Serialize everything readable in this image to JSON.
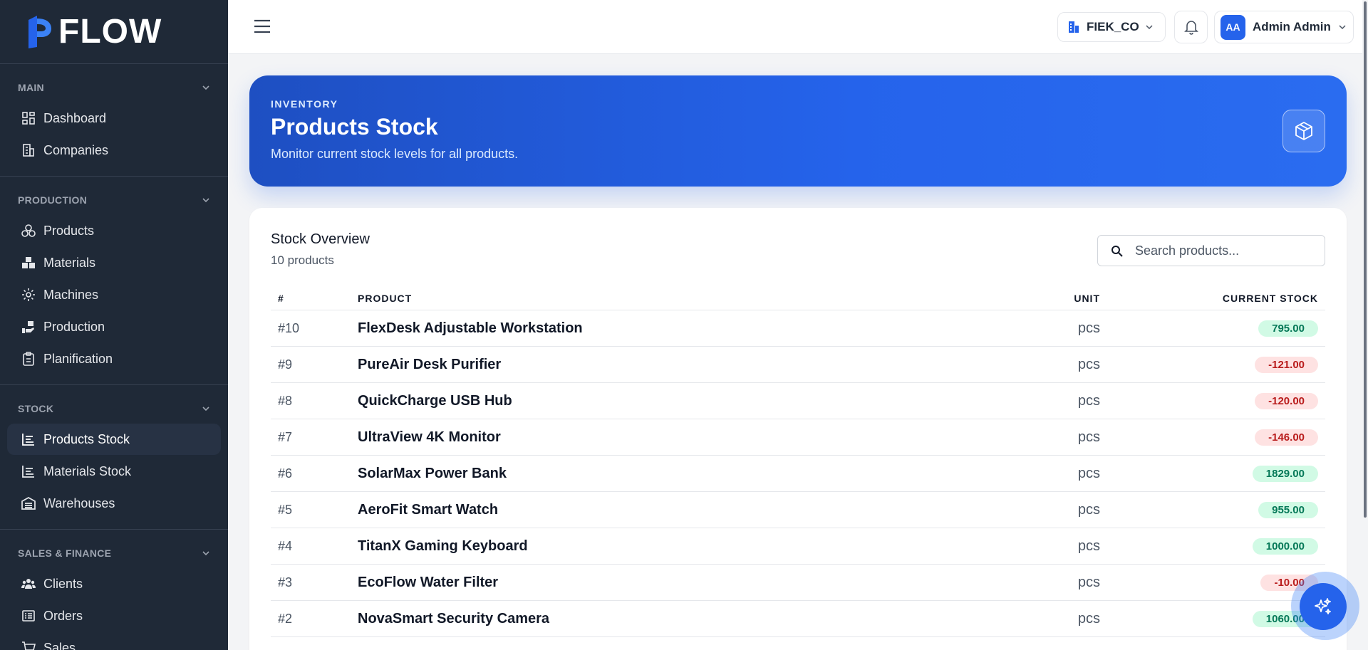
{
  "app": {
    "logo_text": "FLOW"
  },
  "sidebar": {
    "sections": [
      {
        "title": "MAIN",
        "items": [
          {
            "label": "Dashboard",
            "icon": "dashboard-icon"
          },
          {
            "label": "Companies",
            "icon": "building-icon"
          }
        ]
      },
      {
        "title": "PRODUCTION",
        "items": [
          {
            "label": "Products",
            "icon": "products-icon"
          },
          {
            "label": "Materials",
            "icon": "boxes-icon"
          },
          {
            "label": "Machines",
            "icon": "gear-icon"
          },
          {
            "label": "Production",
            "icon": "hand-box-icon"
          },
          {
            "label": "Planification",
            "icon": "clipboard-icon"
          }
        ]
      },
      {
        "title": "STOCK",
        "items": [
          {
            "label": "Products Stock",
            "icon": "chart-icon",
            "active": true
          },
          {
            "label": "Materials Stock",
            "icon": "chart-icon"
          },
          {
            "label": "Warehouses",
            "icon": "warehouse-icon"
          }
        ]
      },
      {
        "title": "SALES & FINANCE",
        "items": [
          {
            "label": "Clients",
            "icon": "users-icon"
          },
          {
            "label": "Orders",
            "icon": "orders-icon"
          },
          {
            "label": "Sales",
            "icon": "cart-icon"
          }
        ]
      }
    ]
  },
  "topbar": {
    "company": "FIEK_CO",
    "user_initials": "AA",
    "user_name": "Admin Admin"
  },
  "banner": {
    "eyebrow": "INVENTORY",
    "title": "Products Stock",
    "subtitle": "Monitor current stock levels for all products."
  },
  "card": {
    "title": "Stock Overview",
    "subtitle": "10 products",
    "search_placeholder": "Search products..."
  },
  "table": {
    "headers": {
      "num": "#",
      "product": "PRODUCT",
      "unit": "UNIT",
      "stock": "CURRENT STOCK"
    },
    "rows": [
      {
        "num": "#10",
        "product": "FlexDesk Adjustable Workstation",
        "unit": "pcs",
        "stock": "795.00",
        "status": "pos"
      },
      {
        "num": "#9",
        "product": "PureAir Desk Purifier",
        "unit": "pcs",
        "stock": "-121.00",
        "status": "neg"
      },
      {
        "num": "#8",
        "product": "QuickCharge USB Hub",
        "unit": "pcs",
        "stock": "-120.00",
        "status": "neg"
      },
      {
        "num": "#7",
        "product": "UltraView 4K Monitor",
        "unit": "pcs",
        "stock": "-146.00",
        "status": "neg"
      },
      {
        "num": "#6",
        "product": "SolarMax Power Bank",
        "unit": "pcs",
        "stock": "1829.00",
        "status": "pos"
      },
      {
        "num": "#5",
        "product": "AeroFit Smart Watch",
        "unit": "pcs",
        "stock": "955.00",
        "status": "pos"
      },
      {
        "num": "#4",
        "product": "TitanX Gaming Keyboard",
        "unit": "pcs",
        "stock": "1000.00",
        "status": "pos"
      },
      {
        "num": "#3",
        "product": "EcoFlow Water Filter",
        "unit": "pcs",
        "stock": "-10.00",
        "status": "neg"
      },
      {
        "num": "#2",
        "product": "NovaSmart Security Camera",
        "unit": "pcs",
        "stock": "1060.00",
        "status": "pos"
      }
    ]
  },
  "colors": {
    "accent": "#2563eb",
    "sidebar_bg": "#1f2937",
    "positive": "#047857",
    "negative": "#b91c1c"
  }
}
